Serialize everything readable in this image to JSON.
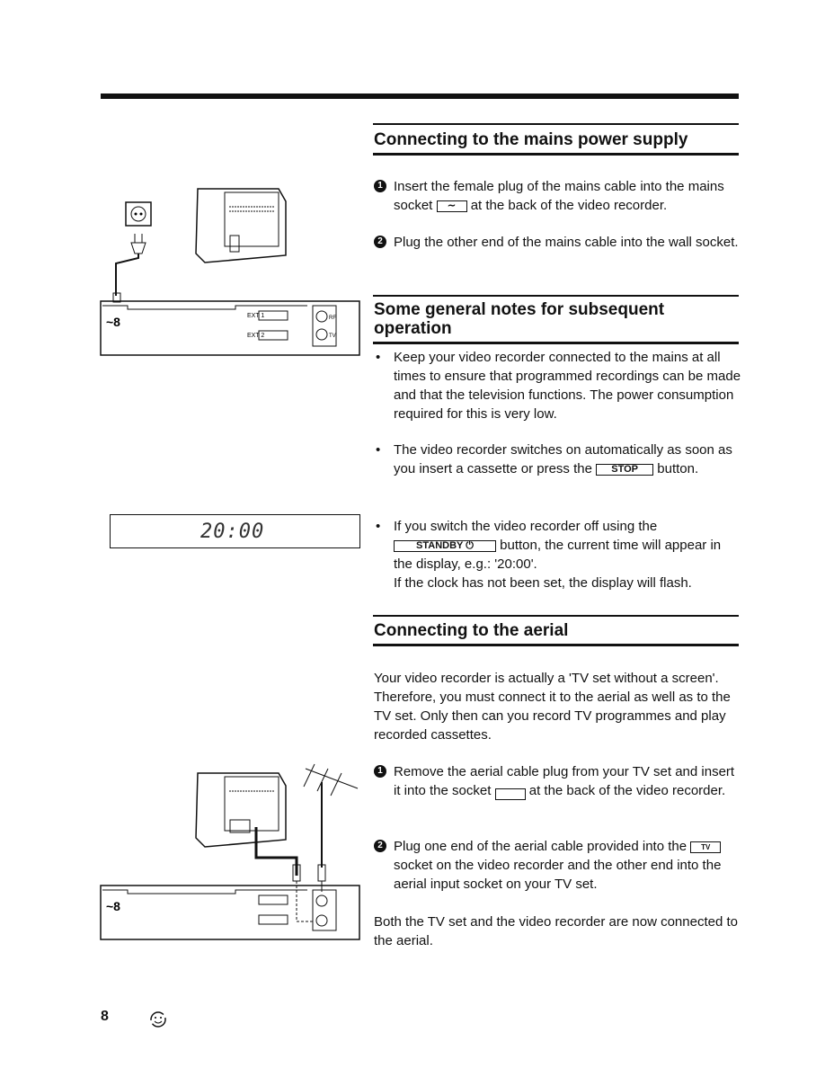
{
  "sections": {
    "mains": {
      "title": "Connecting to the mains power supply",
      "steps": [
        {
          "num": "1",
          "pre": "Insert the female plug of the mains cable into the mains socket ",
          "symbol": "∼",
          "post": " at the back of the video recorder."
        },
        {
          "num": "2",
          "text": "Plug the other end of the mains cable into the wall socket."
        }
      ]
    },
    "notes": {
      "title": "Some general notes for subsequent operation",
      "bullets": [
        {
          "text": "Keep your video recorder connected to the mains at all times to ensure that programmed recordings can be made and that the television functions. The power consumption required for this is very low."
        },
        {
          "pre": "The video recorder switches on automatically as soon as you insert a cassette or press the ",
          "button": "STOP",
          "post": " button."
        },
        {
          "button": "STANDBY ⏻",
          "pre": "If you switch the video recorder off using the ",
          "post": " button, the current time will appear in the display, e.g.: '20:00'.",
          "extra": "If the clock has not been set, the display will flash."
        }
      ]
    },
    "aerial": {
      "title": "Connecting to the aerial",
      "intro": "Your video recorder is actually a 'TV set without a screen'. Therefore, you must connect it to the aerial as well as to the TV set. Only then can you record TV programmes and play recorded cassettes.",
      "steps": [
        {
          "num": "1",
          "pre": "Remove the aerial cable plug from your TV set and insert it into the socket ",
          "symbol": "aerial-in",
          "post": " at the back of the video recorder."
        },
        {
          "num": "2",
          "pre": "Plug one end of the aerial cable provided into the ",
          "symbol": "TV",
          "post": " socket on the video recorder and the other end into the aerial input socket on your TV set."
        }
      ],
      "outro": "Both the TV set and the video recorder are now connected to the aerial."
    }
  },
  "display": {
    "time": "20:00"
  },
  "diagram": {
    "ext1": "EXT 1",
    "ext2": "EXT 2",
    "rf": "RF",
    "tv": "TV"
  },
  "footer": {
    "page_number": "8",
    "icon": "recycle-smiley-icon"
  }
}
